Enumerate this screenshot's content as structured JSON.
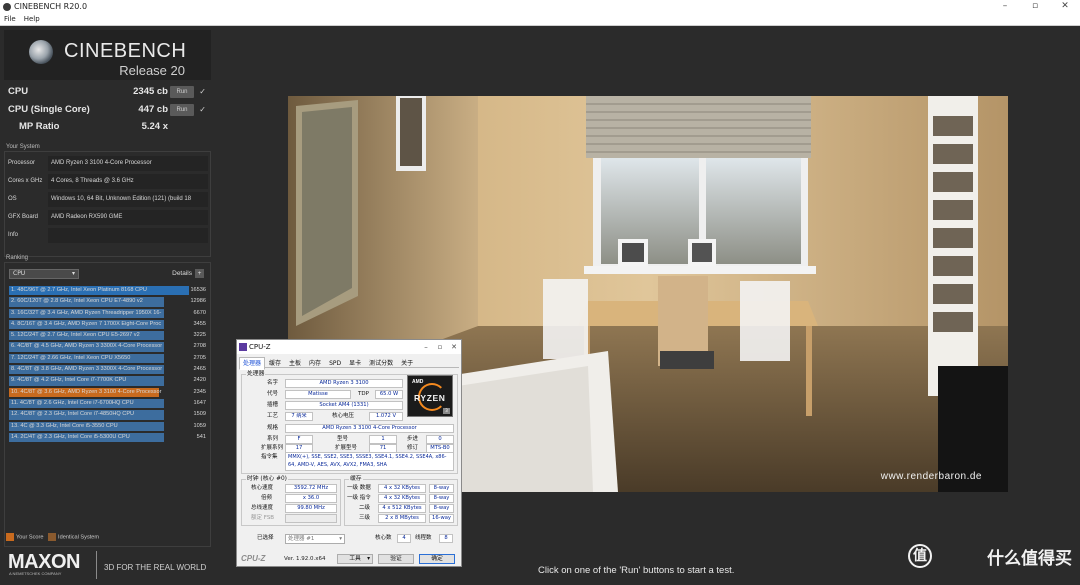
{
  "window": {
    "title": "CINEBENCH R20.0",
    "menu": [
      "File",
      "Help"
    ]
  },
  "logo": {
    "title": "CINEBENCH",
    "subtitle": "Release 20"
  },
  "scores": {
    "cpu": {
      "label": "CPU",
      "value": "2345 cb",
      "run": "Run"
    },
    "cpu_single": {
      "label": "CPU (Single Core)",
      "value": "447 cb",
      "run": "Run"
    },
    "mp_ratio": {
      "label": "MP Ratio",
      "value": "5.24 x"
    }
  },
  "your_system": {
    "heading": "Your System",
    "rows": [
      {
        "key": "Processor",
        "value": "AMD Ryzen 3 3100 4-Core Processor"
      },
      {
        "key": "Cores x GHz",
        "value": "4 Cores, 8 Threads @ 3.6 GHz"
      },
      {
        "key": "OS",
        "value": "Windows 10, 64 Bit, Unknown Edition (121) (build 18"
      },
      {
        "key": "GFX Board",
        "value": "AMD Radeon RX590 GME"
      },
      {
        "key": "Info",
        "value": ""
      }
    ]
  },
  "ranking": {
    "heading": "Ranking",
    "select": "CPU",
    "details": "Details",
    "items": [
      {
        "text": "1. 48C/96T @ 2.7 GHz, Intel Xeon Platinum 8168 CPU",
        "score": "16536",
        "fraction": 1.0
      },
      {
        "text": "2. 60C/120T @ 2.8 GHz, Intel Xeon CPU E7-4890 v2",
        "score": "12986",
        "fraction": 0.785
      },
      {
        "text": "3. 16C/32T @ 3.4 GHz, AMD Ryzen Threadripper 1950X 16-",
        "score": "6670",
        "fraction": 0.403
      },
      {
        "text": "4. 8C/16T @ 3.4 GHz, AMD Ryzen 7 1700X Eight-Core Proc",
        "score": "3455",
        "fraction": 0.209
      },
      {
        "text": "5. 12C/24T @ 2.7 GHz, Intel Xeon CPU E5-2697 v2",
        "score": "3225",
        "fraction": 0.195
      },
      {
        "text": "6. 4C/8T @ 4.5 GHz, AMD Ryzen 3 3300X 4-Core Processor",
        "score": "2708",
        "fraction": 0.164
      },
      {
        "text": "7. 12C/24T @ 2.66 GHz, Intel Xeon CPU X5650",
        "score": "2705",
        "fraction": 0.164
      },
      {
        "text": "8. 4C/8T @ 3.8 GHz, AMD Ryzen 3 3300X 4-Core Processor",
        "score": "2465",
        "fraction": 0.149
      },
      {
        "text": "9. 4C/8T @ 4.2 GHz, Intel Core i7-7700K CPU",
        "score": "2420",
        "fraction": 0.146
      },
      {
        "text": "10. 4C/8T @ 3.6 GHz, AMD Ryzen 3 3100 4-Core Processor",
        "score": "2345",
        "fraction": 0.142,
        "highlight": true
      },
      {
        "text": "11. 4C/8T @ 2.6 GHz, Intel Core i7-6700HQ CPU",
        "score": "1647",
        "fraction": 0.1
      },
      {
        "text": "12. 4C/8T @ 2.3 GHz, Intel Core i7-4850HQ CPU",
        "score": "1509",
        "fraction": 0.091
      },
      {
        "text": "13. 4C @ 3.3 GHz, Intel Core i5-3550 CPU",
        "score": "1059",
        "fraction": 0.064
      },
      {
        "text": "14. 2C/4T @ 2.3 GHz, Intel Core i5-5300U CPU",
        "score": "541",
        "fraction": 0.033
      }
    ],
    "legend": {
      "your_score": "Your Score",
      "identical": "Identical System"
    }
  },
  "branding": {
    "maxon": "MAXON",
    "maxon_sub": "A NEMETSCHEK COMPANY",
    "tagline": "3D FOR THE REAL WORLD"
  },
  "render": {
    "watermark": "www.renderbaron.de"
  },
  "status": "Click on one of the 'Run' buttons to start a test.",
  "overlay_brand": "什么值得买",
  "cpuz": {
    "title": "CPU-Z",
    "tabs": [
      "处理器",
      "缓存",
      "主板",
      "内存",
      "SPD",
      "显卡",
      "测试分数",
      "关于"
    ],
    "processor_group": "处理器",
    "name_label": "名字",
    "name": "AMD Ryzen 3 3100",
    "codename_label": "代号",
    "codename": "Matisse",
    "tdp_label": "TDP",
    "tdp": "65.0 W",
    "package_label": "插槽",
    "package": "Socket AM4 (1331)",
    "tech_label": "工艺",
    "tech": "7 纳米",
    "voltage_label": "核心电压",
    "voltage": "1.072 V",
    "spec_label": "规格",
    "spec": "AMD Ryzen 3 3100 4-Core Processor",
    "family_label": "系列",
    "family": "F",
    "model_label": "型号",
    "model": "1",
    "stepping_label": "步进",
    "stepping": "0",
    "extfamily_label": "扩展系列",
    "extfamily": "17",
    "extmodel_label": "扩展型号",
    "extmodel": "71",
    "revision_label": "修订",
    "revision": "MTS-B0",
    "instr_label": "指令集",
    "instructions": "MMX(+), SSE, SSE2, SSE3, SSSE3, SSE4.1, SSE4.2, SSE4A, x86-64, AMD-V, AES, AVX, AVX2, FMA3, SHA",
    "clocks_group": "时钟 (核心 #0)",
    "core_speed_label": "核心速度",
    "core_speed": "3592.72 MHz",
    "multiplier_label": "倍频",
    "multiplier": "x 36.0",
    "bus_label": "总线速度",
    "bus": "99.80 MHz",
    "fsb_label": "额定 FSB",
    "cache_group": "缓存",
    "l1d_label": "一级 数据",
    "l1d": "4 x 32 KBytes",
    "l1d_way": "8-way",
    "l1i_label": "一级 指令",
    "l1i": "4 x 32 KBytes",
    "l1i_way": "8-way",
    "l2_label": "二级",
    "l2": "4 x 512 KBytes",
    "l2_way": "8-way",
    "l3_label": "三级",
    "l3": "2 x 8 MBytes",
    "l3_way": "16-way",
    "selection_label": "已选择",
    "selection": "处理器 #1",
    "cores_label": "核心数",
    "cores": "4",
    "threads_label": "线程数",
    "threads": "8",
    "brand": "CPU-Z",
    "version": "Ver. 1.92.0.x64",
    "tools": "工具",
    "validate": "验证",
    "ok": "确定",
    "amd_text": "AMD",
    "ryzen_text": "RYZEN"
  }
}
